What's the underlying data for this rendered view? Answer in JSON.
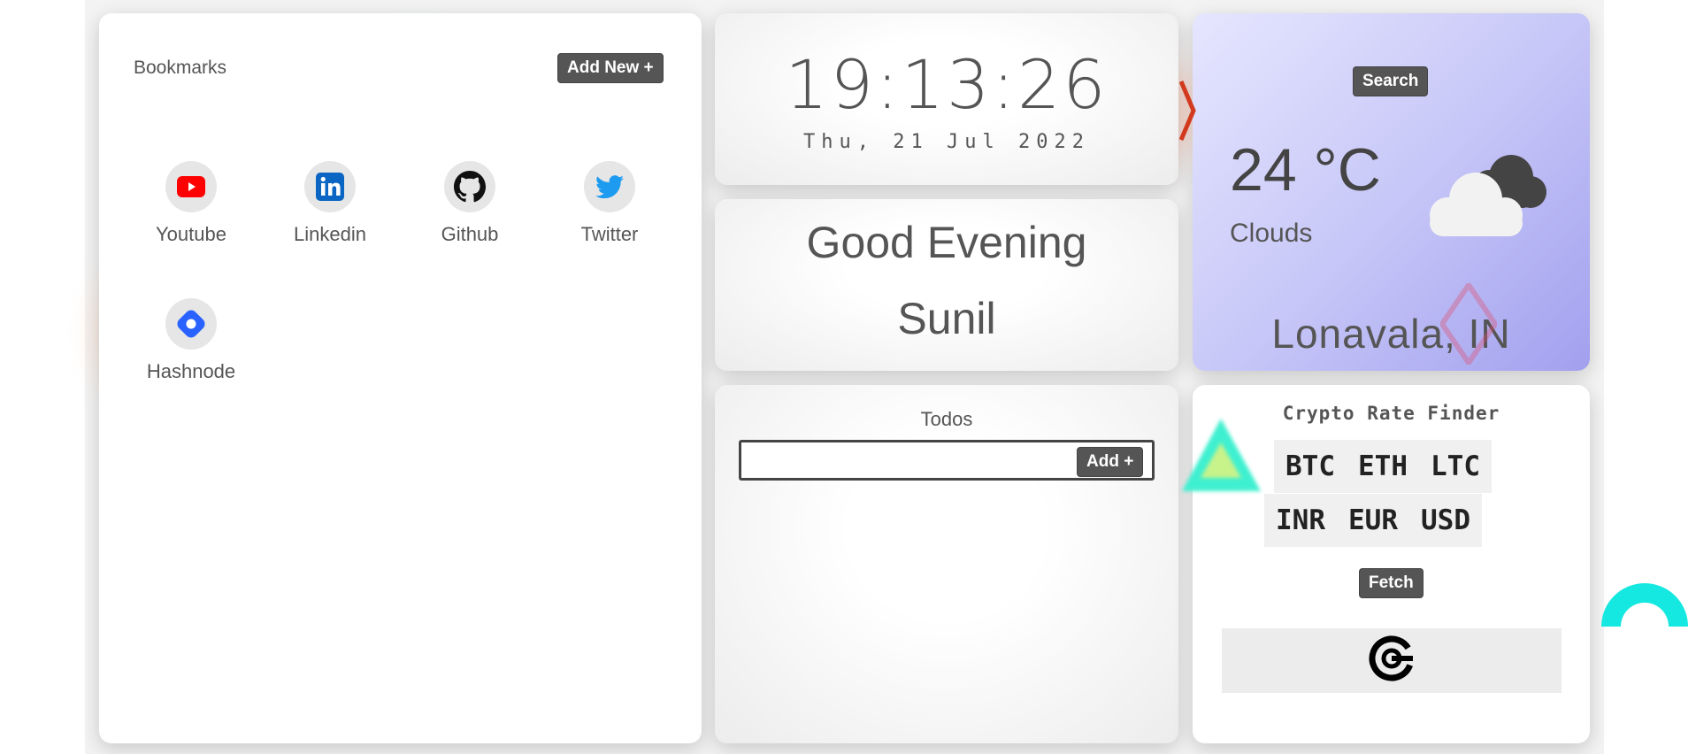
{
  "bookmarks": {
    "title": "Bookmarks",
    "add_label": "Add New +",
    "items": [
      {
        "label": "Youtube",
        "icon": "youtube-icon"
      },
      {
        "label": "Linkedin",
        "icon": "linkedin-icon"
      },
      {
        "label": "Github",
        "icon": "github-icon"
      },
      {
        "label": "Twitter",
        "icon": "twitter-icon"
      },
      {
        "label": "Hashnode",
        "icon": "hashnode-icon"
      }
    ]
  },
  "clock": {
    "time": "19:13:26",
    "date": "Thu, 21 Jul 2022"
  },
  "greeting": {
    "line1": "Good Evening",
    "name": "Sunil"
  },
  "weather": {
    "search_label": "Search",
    "temperature": "24 °C",
    "condition": "Clouds",
    "location": "Lonavala, IN",
    "icon": "cloud-icon"
  },
  "todos": {
    "title": "Todos",
    "input_value": "",
    "add_label": "Add +"
  },
  "crypto": {
    "title": "Crypto Rate Finder",
    "coins": [
      "BTC",
      "ETH",
      "LTC"
    ],
    "currencies": [
      "INR",
      "EUR",
      "USD"
    ],
    "fetch_label": "Fetch",
    "result_icon": "crypto-logo-icon"
  },
  "colors": {
    "button": "#555555",
    "youtube": "#ff0000",
    "linkedin": "#0a66c2",
    "twitter": "#1d9bf0",
    "hashnode": "#2962ff"
  }
}
